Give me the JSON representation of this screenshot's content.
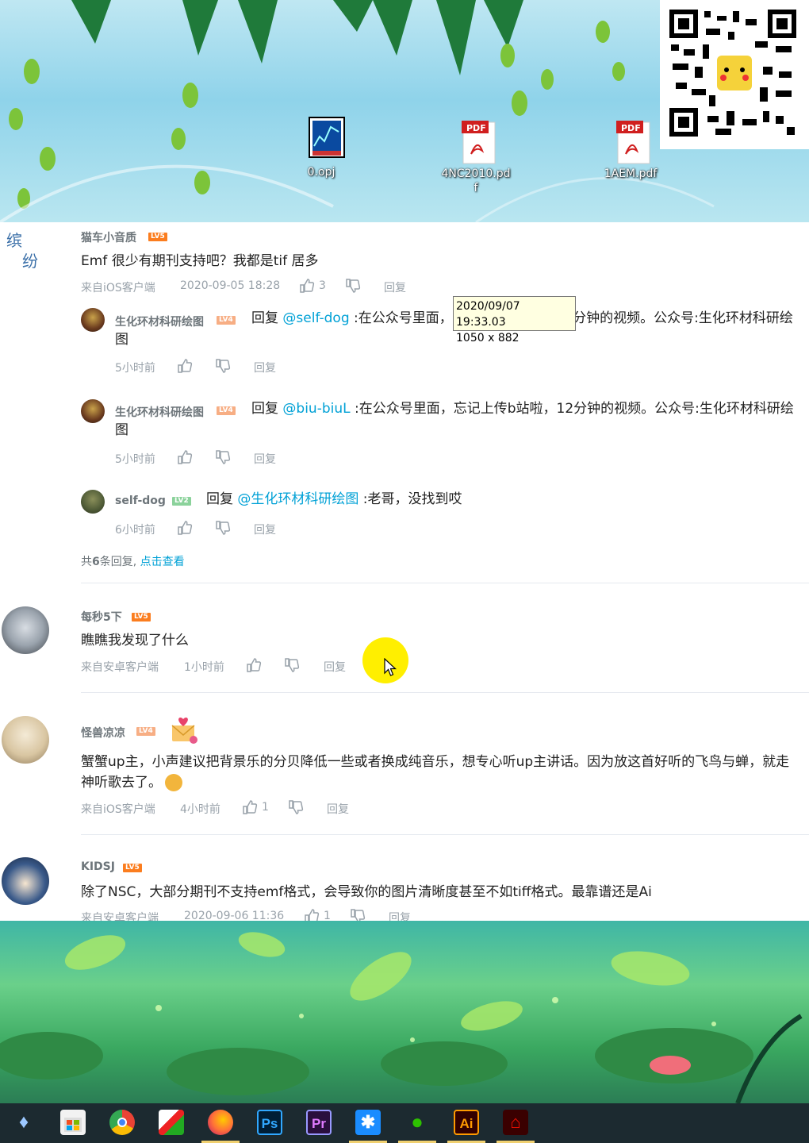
{
  "desktop": {
    "icons": [
      {
        "name": "0.opj"
      },
      {
        "name": "4NC2010.pdf"
      },
      {
        "name": "1AEM.pdf"
      }
    ],
    "pdf_badge": "PDF"
  },
  "tooltip": {
    "line1": "2020/09/07 19:33.03",
    "line2": "1050 x 882"
  },
  "comments": [
    {
      "user": "猫车小音质",
      "level": "LV5",
      "text": "Emf 很少有期刊支持吧？我都是tif 居多",
      "source": "来自iOS客户端",
      "time": "2020-09-05 18:28",
      "likes": "3",
      "reply_label": "回复",
      "replies": [
        {
          "user": "生化环材科研绘图",
          "level": "LV4",
          "prefix": "回复 ",
          "mention": "@self-dog",
          "text": " :在公众号里面，忘记上传b站啦，12分钟的视频。公众号:生化环材科研绘",
          "text2": "图",
          "time": "5小时前",
          "reply_label": "回复"
        },
        {
          "user": "生化环材科研绘图",
          "level": "LV4",
          "prefix": "回复 ",
          "mention": "@biu-biuL",
          "text": " :在公众号里面，忘记上传b站啦，12分钟的视频。公众号:生化环材科研绘",
          "text2": "图",
          "time": "5小时前",
          "reply_label": "回复"
        },
        {
          "user": "self-dog",
          "level": "LV2",
          "prefix": "回复 ",
          "mention": "@生化环材科研绘图",
          "text": " :老哥，没找到哎",
          "time": "6小时前",
          "reply_label": "回复"
        }
      ],
      "more": {
        "count_prefix": "共",
        "count": "6",
        "count_suffix": "条回复,",
        "link": "点击查看"
      }
    },
    {
      "user": "每秒5下",
      "level": "LV5",
      "text": "瞧瞧我发现了什么",
      "source": "来自安卓客户端",
      "time": "1小时前",
      "reply_label": "回复"
    },
    {
      "user": "怪兽凉凉",
      "level": "LV4",
      "text": "蟹蟹up主，小声建议把背景乐的分贝降低一些或者换成纯音乐，想专心听up主讲话。因为放这首好听的飞鸟与蝉，就走",
      "text2": "神听歌去了。",
      "source": "来自iOS客户端",
      "time": "4小时前",
      "likes": "1",
      "reply_label": "回复"
    },
    {
      "user": "KIDSJ",
      "level": "LV5",
      "text": "除了NSC，大部分期刊不支持emf格式，会导致你的图片清晰度甚至不如tiff格式。最靠谱还是Ai",
      "source": "来自安卓客户端",
      "time": "2020-09-06 11:36",
      "likes": "1",
      "reply_label": "回复"
    }
  ],
  "taskbar": {
    "apps": [
      {
        "icon": "diamond-icon"
      },
      {
        "icon": "store-icon"
      },
      {
        "icon": "chrome-icon"
      },
      {
        "icon": "app-icon"
      },
      {
        "icon": "firefox-icon"
      },
      {
        "icon": "photoshop-icon",
        "label": "Ps"
      },
      {
        "icon": "premiere-icon",
        "label": "Pr"
      },
      {
        "icon": "star-app-icon"
      },
      {
        "icon": "wechat-icon"
      },
      {
        "icon": "illustrator-icon",
        "label": "Ai"
      },
      {
        "icon": "acrobat-icon"
      }
    ]
  }
}
